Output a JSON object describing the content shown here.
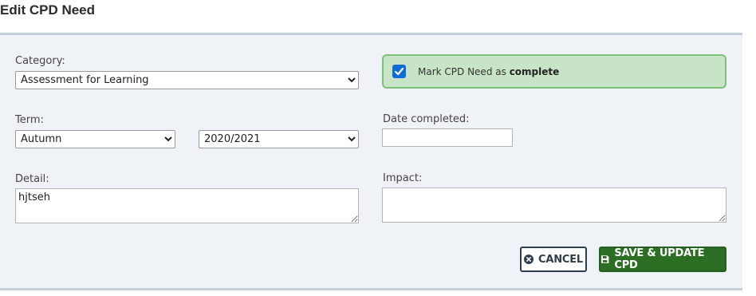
{
  "page_title": "Edit CPD Need",
  "form": {
    "category": {
      "label": "Category:",
      "value": "Assessment for Learning"
    },
    "complete": {
      "checked": true,
      "text_prefix": "Mark CPD Need as",
      "text_bold": "complete"
    },
    "term": {
      "label": "Term:",
      "value": "Autumn",
      "year_value": "2020/2021"
    },
    "date_completed": {
      "label": "Date completed:",
      "value": ""
    },
    "detail": {
      "label": "Detail:",
      "value": "hjtseh"
    },
    "impact": {
      "label": "Impact:",
      "value": ""
    }
  },
  "buttons": {
    "cancel_label": "CANCEL",
    "save_label": "SAVE & UPDATE CPD"
  },
  "icons": {
    "cancel": "times-circle-icon",
    "save": "floppy-disk-icon",
    "check": "checkmark-icon"
  },
  "colors": {
    "panel_bg": "#eff3f8",
    "panel_border": "#c2cfdd",
    "complete_bg": "#c8e4c6",
    "complete_border": "#7cc07a",
    "save_bg": "#2d6e25",
    "checkbox": "#0e6cd8"
  }
}
